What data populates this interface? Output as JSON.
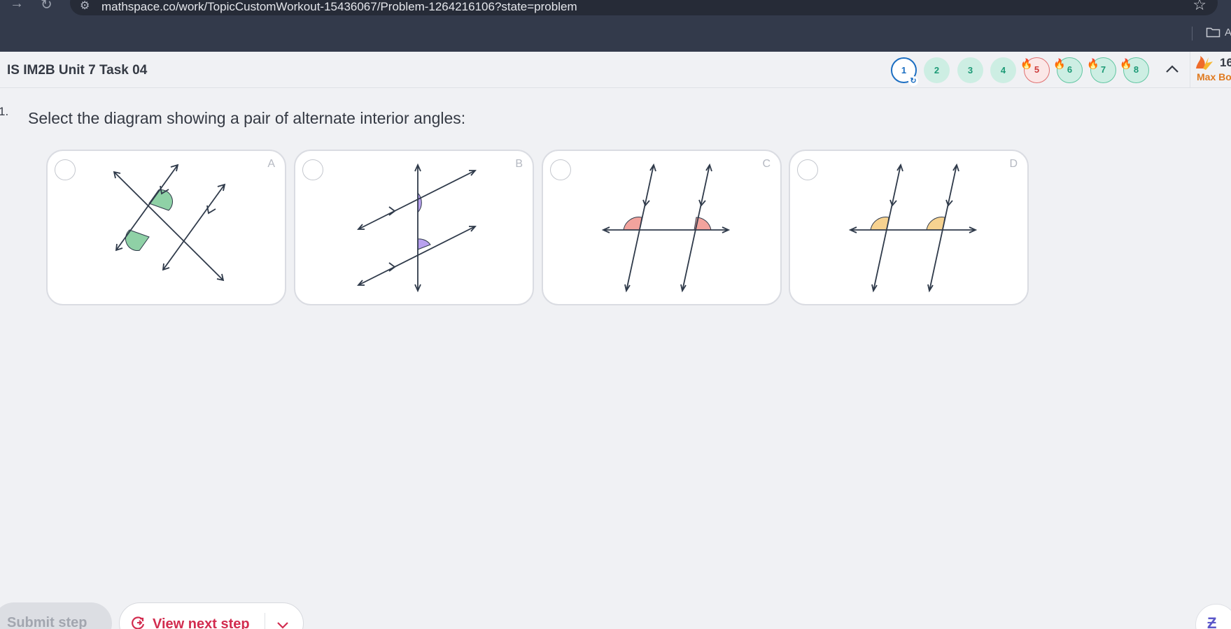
{
  "browser": {
    "url": "mathspace.co/work/TopicCustomWorkout-15436067/Problem-1264216106?state=problem",
    "bookmark_label": "A"
  },
  "header": {
    "task_title": "IS IM2B Unit 7 Task 04",
    "questions": [
      {
        "label": "1",
        "state": "current"
      },
      {
        "label": "2",
        "state": "done"
      },
      {
        "label": "3",
        "state": "done"
      },
      {
        "label": "4",
        "state": "done"
      },
      {
        "label": "5",
        "state": "fire-red"
      },
      {
        "label": "6",
        "state": "fire-green"
      },
      {
        "label": "7",
        "state": "fire-green"
      },
      {
        "label": "8",
        "state": "fire-green"
      }
    ],
    "streak": {
      "count": "16",
      "label": "Max Bo"
    }
  },
  "question": {
    "number": "1.",
    "prompt": "Select the diagram showing a pair of alternate interior angles:",
    "choices": [
      {
        "letter": "A",
        "angle_color": "#8fd1a6"
      },
      {
        "letter": "B",
        "angle_color": "#b9a1ef"
      },
      {
        "letter": "C",
        "angle_color": "#f2a39d"
      },
      {
        "letter": "D",
        "angle_color": "#f6d290"
      }
    ]
  },
  "footer": {
    "submit_label": "Submit step",
    "next_label": "View next step"
  }
}
